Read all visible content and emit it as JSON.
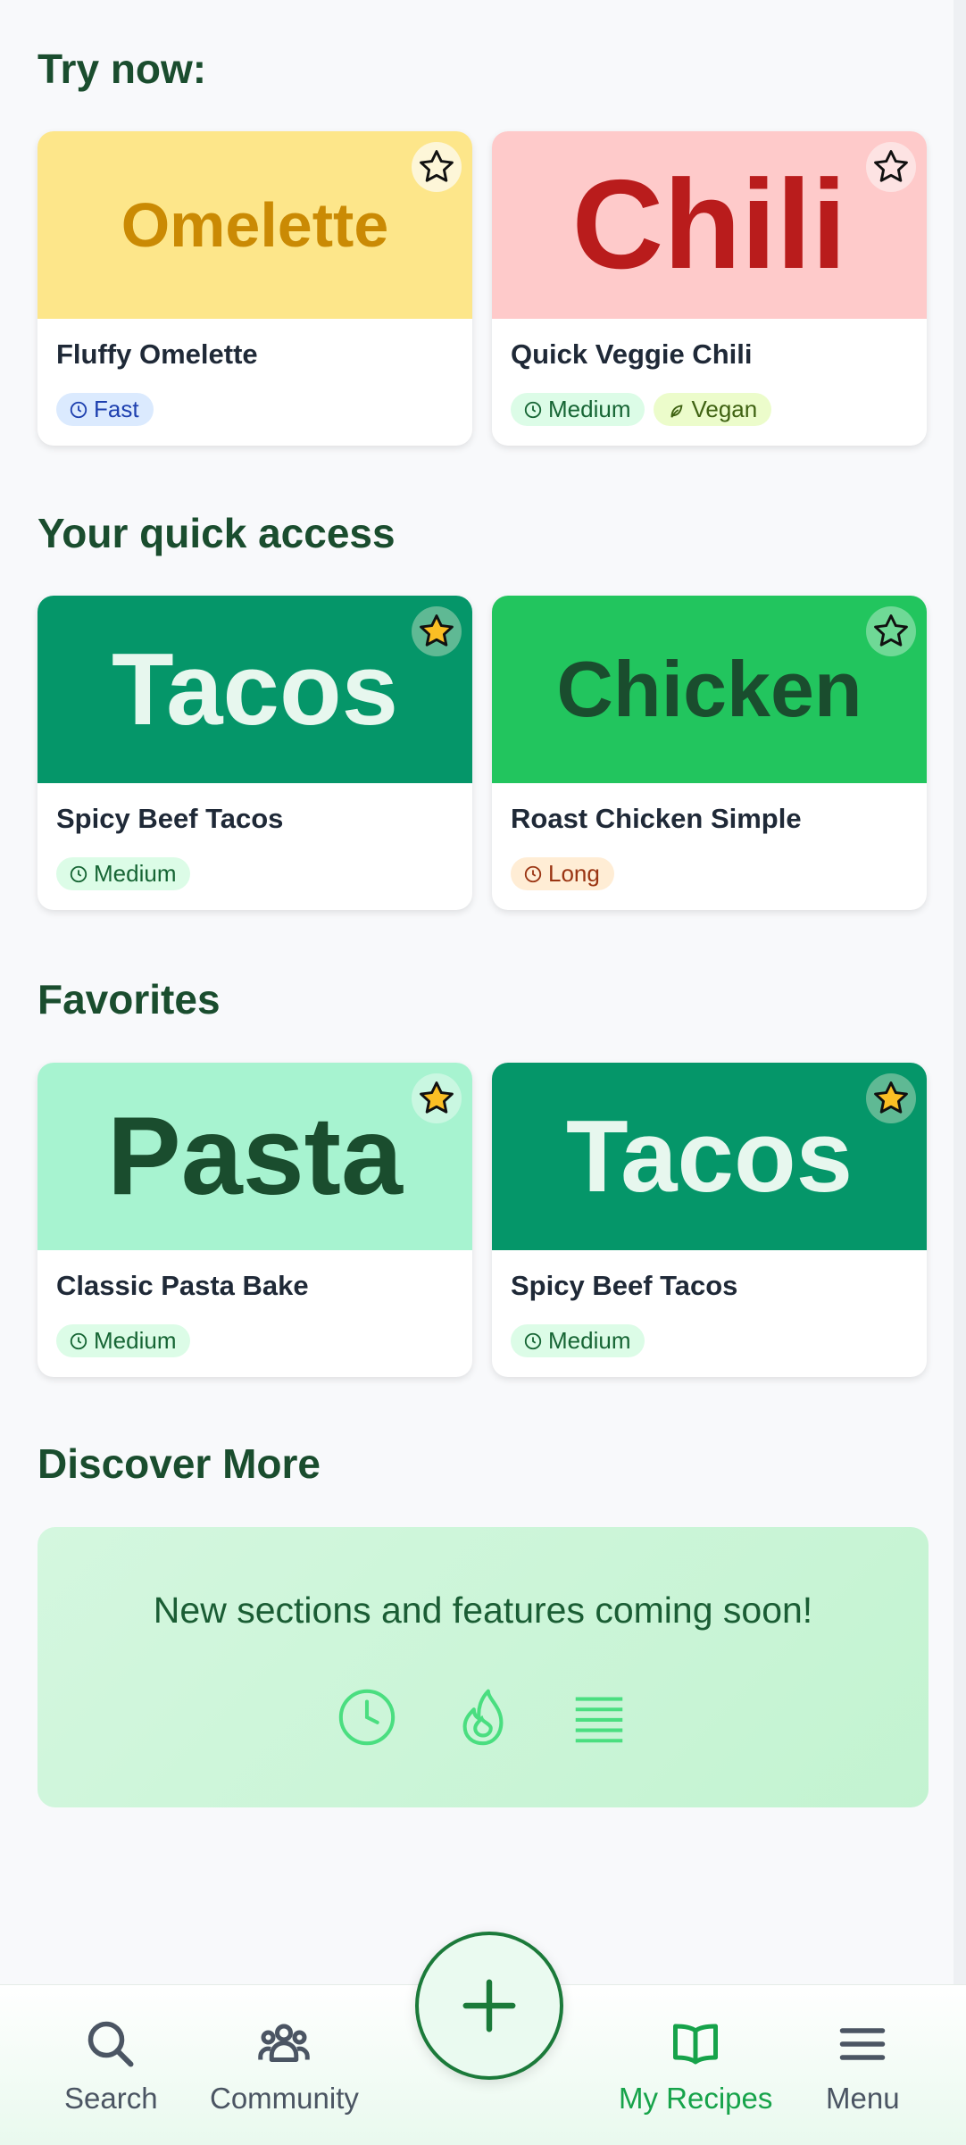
{
  "sections": {
    "try_now": "Try now:",
    "quick_access": "Your quick access",
    "favorites": "Favorites",
    "discover": "Discover More"
  },
  "cards": [
    {
      "banner": "Omelette",
      "name": "Fluffy Omelette",
      "starred": false,
      "tags": [
        {
          "label": "Fast",
          "icon": "clock-icon"
        }
      ]
    },
    {
      "banner": "Chili",
      "name": "Quick Veggie Chili",
      "starred": false,
      "tags": [
        {
          "label": "Medium",
          "icon": "clock-icon"
        },
        {
          "label": "Vegan",
          "icon": "leaf-icon"
        }
      ]
    },
    {
      "banner": "Tacos",
      "name": "Spicy Beef Tacos",
      "starred": true,
      "tags": [
        {
          "label": "Medium",
          "icon": "clock-icon"
        }
      ]
    },
    {
      "banner": "Chicken",
      "name": "Roast Chicken Simple",
      "starred": false,
      "tags": [
        {
          "label": "Long",
          "icon": "clock-icon"
        }
      ]
    },
    {
      "banner": "Pasta",
      "name": "Classic Pasta Bake",
      "starred": true,
      "tags": [
        {
          "label": "Medium",
          "icon": "clock-icon"
        }
      ]
    },
    {
      "banner": "Tacos",
      "name": "Spicy Beef Tacos",
      "starred": true,
      "tags": [
        {
          "label": "Medium",
          "icon": "clock-icon"
        }
      ]
    }
  ],
  "discover": {
    "message": "New sections and features coming soon!",
    "icons": [
      "clock-icon",
      "flame-icon",
      "list-icon"
    ]
  },
  "nav": {
    "search": "Search",
    "community": "Community",
    "add_icon": "plus-icon",
    "my_recipes": "My Recipes",
    "menu": "Menu",
    "active": "My Recipes"
  },
  "colors": {
    "heading": "#1a4d2e",
    "accent": "#16a34a",
    "star": "#fbbf24",
    "omelette_bg": "#fde68a",
    "chili_bg": "#fecaca",
    "tacos_bg": "#059669",
    "chicken_bg": "#22c55e",
    "pasta_bg": "#a7f3d0"
  }
}
